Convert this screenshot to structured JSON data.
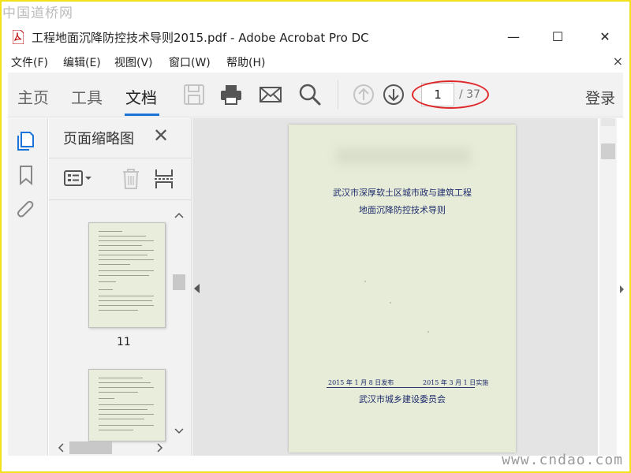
{
  "watermarks": {
    "top": "中国道桥网",
    "bottom": "www.cndao.com"
  },
  "window": {
    "title": "工程地面沉降防控技术导则2015.pdf - Adobe Acrobat Pro DC",
    "minimize": "—",
    "maximize": "☐",
    "close": "✕"
  },
  "menu": {
    "items": [
      "文件(F)",
      "编辑(E)",
      "视图(V)",
      "窗口(W)",
      "帮助(H)"
    ],
    "close": "×"
  },
  "toolbar": {
    "tabs": [
      "主页",
      "工具",
      "文档"
    ],
    "active_tab": "文档",
    "page_current": "1",
    "page_total": "/ 37",
    "login": "登录",
    "accent": "#1a73d9",
    "highlight_color": "#e0282a"
  },
  "thumbnails": {
    "panel_title": "页面缩略图",
    "close": "✕",
    "page_label": "11"
  },
  "document": {
    "title_line1": "武汉市深厚软土区城市政与建筑工程",
    "title_line2": "地面沉降防控技术导则",
    "date_issued": "2015 年 1 月 8 日发布",
    "date_effective": "2015 年 3 月 1 日实施",
    "organization": "武汉市城乡建设委员会"
  }
}
